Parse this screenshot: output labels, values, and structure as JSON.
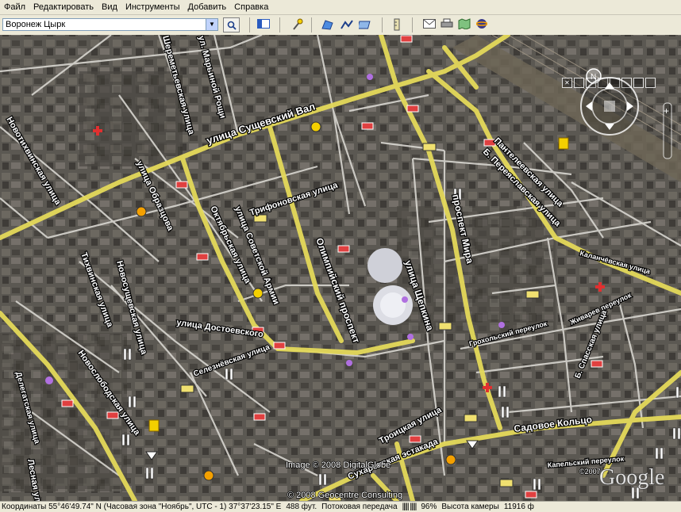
{
  "menu": [
    "Файл",
    "Редактировать",
    "Вид",
    "Инструменты",
    "Добавить",
    "Справка"
  ],
  "search": {
    "value": "Воронеж Цырк"
  },
  "toolbar_icons": [
    "sidebar-toggle-icon",
    "placemark-icon",
    "polygon-icon",
    "path-icon",
    "image-overlay-icon",
    "ruler-icon",
    "email-icon",
    "print-icon",
    "maps-icon",
    "sky-icon"
  ],
  "streets": {
    "suschevsky_val": "улица Сущевский Вал",
    "novotikhvinskaya": "Новотихвинская улица",
    "obraztsova": "улица Образцова",
    "sheremetyevskaya": "Шереметьевская улица",
    "marinoy_roschi": "ул. Марьиной Рощи",
    "trifonovskaya": "Трифоновская улица",
    "oktyabrskaya": "Октябрьская улица",
    "sovetskoy_armii": "улица Советской Армии",
    "olimpiysky": "Олимпийский проспект",
    "schepkina": "улица Щепкина",
    "prospekt_mira": "проспект Мира",
    "panteleevskaya": "Пантелеевская улица",
    "pereslavskaya": "Б. Переяславская улица",
    "dostoevskogo": "улица Достоевского",
    "tikhvinskaya": "Тихвинская улица",
    "novoschevskaya": "Новосущевская улица",
    "novoslobodskaya": "Новослободская улица",
    "selezvenskaya": "Селезнёвская улица",
    "troitskaya": "Троицкая улица",
    "sadovoe": "Садовое Кольцо",
    "estakada": "Сухаревская эстакада",
    "grokholsky": "Грохольский переулок",
    "zhivarev": "Живарев переулок",
    "spasskaya": "Б. Спасская улица",
    "kalanchevskaya": "Каланчёвская улица",
    "delegatskaya": "Делегатская улица",
    "lesnaya": "Лесная улица",
    "kapelsky": "Капельский переулок"
  },
  "credits": {
    "image": "Image © 2008 DigitalGlobe",
    "geo": "© 2008 Geocentre Consulting",
    "logo": "Google",
    "year": "©2007"
  },
  "status": {
    "coords": "Координаты  55°46'49.74\" N (Часовая зона \"Ноябрь\", UTC - 1)  37°37'23.15\" E",
    "elev": "488 фут.",
    "stream": "Потоковая передача",
    "percent": "96%",
    "eye": "Высота камеры",
    "eye_val": "11916 ф"
  }
}
